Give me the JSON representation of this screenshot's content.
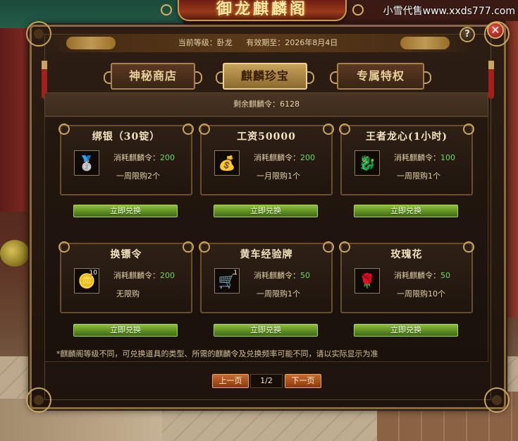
{
  "watermark": "小雪代售www.xxds777.com",
  "window": {
    "title": "御龙麒麟阁",
    "help_label": "?",
    "close_label": "✕"
  },
  "header": {
    "level_label": "当前等级：卧龙",
    "expiry_label": "有效期至：2026年8月4日"
  },
  "tabs": [
    {
      "label": "神秘商店",
      "active": false
    },
    {
      "label": "麒麟珍宝",
      "active": true
    },
    {
      "label": "专属特权",
      "active": false
    }
  ],
  "remaining": "剩余麒麟令：6128",
  "items": [
    {
      "name": "绑银（30锭）",
      "icon": "silver-ingot-icon",
      "glyph": "🥈",
      "qty": "",
      "cost_label": "消耗麒麟令：",
      "cost": "200",
      "limit": "一周限购2个",
      "button": "立即兑换"
    },
    {
      "name": "工资50000",
      "icon": "gold-coins-icon",
      "glyph": "💰",
      "qty": "",
      "cost_label": "消耗麒麟令：",
      "cost": "200",
      "limit": "一月限购1个",
      "button": "立即兑换"
    },
    {
      "name": "王者龙心(1小时)",
      "icon": "dragon-icon",
      "glyph": "🐉",
      "qty": "",
      "cost_label": "消耗麒麟令：",
      "cost": "100",
      "limit": "一周限购1个",
      "button": "立即兑换"
    },
    {
      "name": "换镖令",
      "icon": "token-icon",
      "glyph": "🪙",
      "qty": "10",
      "cost_label": "消耗麒麟令：",
      "cost": "200",
      "limit": "无限购",
      "button": "立即兑换"
    },
    {
      "name": "黄车经验牌",
      "icon": "cart-icon",
      "glyph": "🛒",
      "qty": "1",
      "cost_label": "消耗麒麟令：",
      "cost": "50",
      "limit": "一周限购1个",
      "button": "立即兑换"
    },
    {
      "name": "玫瑰花",
      "icon": "rose-icon",
      "glyph": "🌹",
      "qty": "",
      "cost_label": "消耗麒麟令：",
      "cost": "50",
      "limit": "一周限购10个",
      "button": "立即兑换"
    }
  ],
  "note": "*麒麟阁等级不同，可兑换道具的类型、所需的麒麟令及兑换频率可能不同，请以实际显示为准",
  "pagination": {
    "prev_label": "上一页",
    "current": "1/2",
    "next_label": "下一页"
  }
}
